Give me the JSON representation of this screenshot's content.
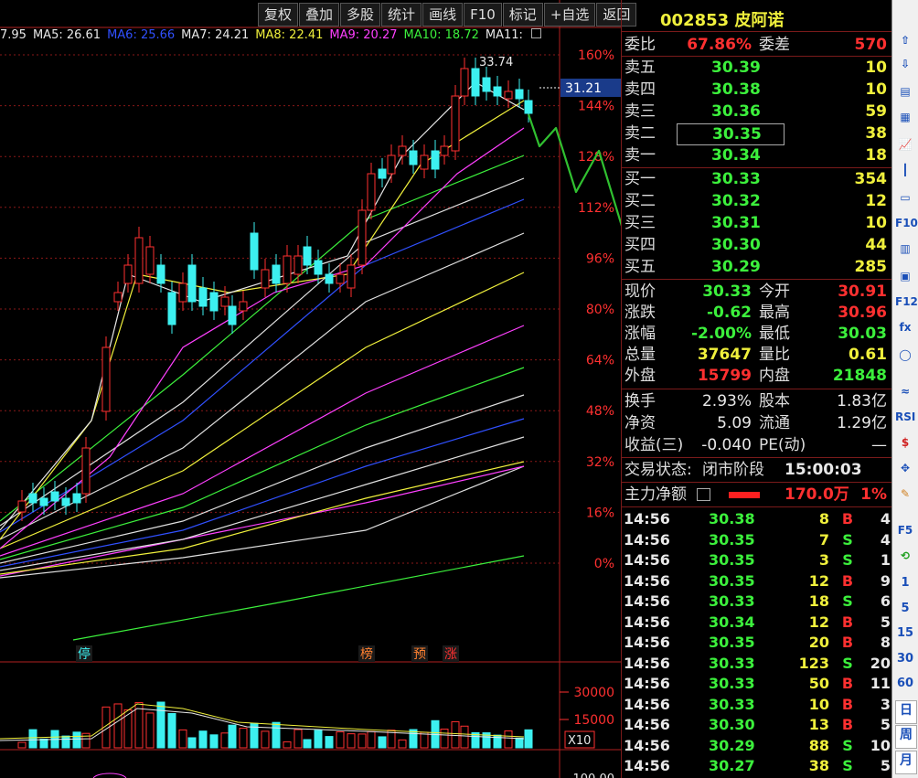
{
  "toolbar": [
    "复权",
    "叠加",
    "多股",
    "统计",
    "画线",
    "F10",
    "标记",
    "+自选",
    "返回"
  ],
  "ma_legend": [
    {
      "label": "7.95",
      "color": "#e8e8e8"
    },
    {
      "label": "MA5: 26.61",
      "color": "#e8e8e8"
    },
    {
      "label": "MA6: 25.66",
      "color": "#3050ff"
    },
    {
      "label": "MA7: 24.21",
      "color": "#e8e8e8"
    },
    {
      "label": "MA8: 22.41",
      "color": "#f0f03c"
    },
    {
      "label": "MA9: 20.27",
      "color": "#ff40ff"
    },
    {
      "label": "MA10: 18.72",
      "color": "#3cf03c"
    },
    {
      "label": "MA11:",
      "color": "#e8e8e8"
    }
  ],
  "axis_pct": [
    "160%",
    "144%",
    "128%",
    "112%",
    "96%",
    "80%",
    "64%",
    "48%",
    "32%",
    "16%",
    "0%"
  ],
  "price_tag": "31.21",
  "high_label": "33.74",
  "markers": [
    {
      "text": "停",
      "color": "#3cf0f0"
    },
    {
      "text": "榜",
      "color": "#ff8030"
    },
    {
      "text": "预",
      "color": "#ff8030"
    },
    {
      "text": "涨",
      "color": "#ff3030"
    }
  ],
  "vol_axis": [
    "30000",
    "15000"
  ],
  "vol_unit": "X10",
  "bottom_axis_label": "100.00",
  "quote": {
    "code": "002853",
    "name": "皮阿诺",
    "weibi_label": "委比",
    "weibi": "67.86%",
    "weicha_label": "委差",
    "weicha": "570",
    "asks": [
      {
        "label": "卖五",
        "price": "30.39",
        "vol": "10"
      },
      {
        "label": "卖四",
        "price": "30.38",
        "vol": "10"
      },
      {
        "label": "卖三",
        "price": "30.36",
        "vol": "59"
      },
      {
        "label": "卖二",
        "price": "30.35",
        "vol": "38"
      },
      {
        "label": "卖一",
        "price": "30.34",
        "vol": "18"
      }
    ],
    "bids": [
      {
        "label": "买一",
        "price": "30.33",
        "vol": "354"
      },
      {
        "label": "买二",
        "price": "30.32",
        "vol": "12"
      },
      {
        "label": "买三",
        "price": "30.31",
        "vol": "10"
      },
      {
        "label": "买四",
        "price": "30.30",
        "vol": "44"
      },
      {
        "label": "买五",
        "price": "30.29",
        "vol": "285"
      }
    ],
    "stats": [
      {
        "l1": "现价",
        "v1": "30.33",
        "c1": "green",
        "l2": "今开",
        "v2": "30.91",
        "c2": "red"
      },
      {
        "l1": "涨跌",
        "v1": "-0.62",
        "c1": "green",
        "l2": "最高",
        "v2": "30.96",
        "c2": "red"
      },
      {
        "l1": "涨幅",
        "v1": "-2.00%",
        "c1": "green",
        "l2": "最低",
        "v2": "30.03",
        "c2": "green"
      },
      {
        "l1": "总量",
        "v1": "37647",
        "c1": "yellow",
        "l2": "量比",
        "v2": "0.61",
        "c2": "yellow"
      },
      {
        "l1": "外盘",
        "v1": "15799",
        "c1": "red",
        "l2": "内盘",
        "v2": "21848",
        "c2": "green"
      }
    ],
    "stats2": [
      {
        "l1": "换手",
        "v1": "2.93%",
        "l2": "股本",
        "v2": "1.83亿"
      },
      {
        "l1": "净资",
        "v1": "5.09",
        "l2": "流通",
        "v2": "1.29亿"
      },
      {
        "l1": "收益(三)",
        "v1": "-0.040",
        "l2": "PE(动)",
        "v2": "—"
      }
    ],
    "trade_state_label": "交易状态:",
    "trade_state": "闭市阶段",
    "trade_time": "15:00:03",
    "main_flow_label": "主力净额",
    "main_flow_value": "170.0万",
    "main_flow_pct": "1%"
  },
  "ticks": [
    {
      "t": "14:56",
      "p": "30.38",
      "q": "8",
      "d": "B",
      "n": "4"
    },
    {
      "t": "14:56",
      "p": "30.35",
      "q": "7",
      "d": "S",
      "n": "4"
    },
    {
      "t": "14:56",
      "p": "30.35",
      "q": "3",
      "d": "S",
      "n": "1"
    },
    {
      "t": "14:56",
      "p": "30.35",
      "q": "12",
      "d": "B",
      "n": "9"
    },
    {
      "t": "14:56",
      "p": "30.33",
      "q": "18",
      "d": "S",
      "n": "6"
    },
    {
      "t": "14:56",
      "p": "30.34",
      "q": "12",
      "d": "B",
      "n": "5"
    },
    {
      "t": "14:56",
      "p": "30.35",
      "q": "20",
      "d": "B",
      "n": "8"
    },
    {
      "t": "14:56",
      "p": "30.33",
      "q": "123",
      "d": "S",
      "n": "20"
    },
    {
      "t": "14:56",
      "p": "30.33",
      "q": "50",
      "d": "B",
      "n": "11"
    },
    {
      "t": "14:56",
      "p": "30.33",
      "q": "10",
      "d": "B",
      "n": "3"
    },
    {
      "t": "14:56",
      "p": "30.30",
      "q": "13",
      "d": "B",
      "n": "5"
    },
    {
      "t": "14:56",
      "p": "30.29",
      "q": "88",
      "d": "S",
      "n": "10"
    },
    {
      "t": "14:56",
      "p": "30.27",
      "q": "38",
      "d": "S",
      "n": "5"
    }
  ],
  "sidebar": {
    "icons": [
      "arrow-up-icon",
      "arrow-down-icon",
      "list-icon",
      "grid-icon",
      "line-chart-icon",
      "candle-icon",
      "window-icon",
      "f10-icon",
      "chart2-icon",
      "doc-icon",
      "f12-icon",
      "fx-icon",
      "circle-icon",
      "wave-icon",
      "rsi-icon",
      "dollar-icon",
      "move-icon",
      "pencil-icon",
      "f5-icon",
      "refresh-icon"
    ],
    "texts": {
      "rsi": "RSI",
      "f5": "F5",
      "f10": "F10",
      "f12": "F12",
      "fx": "fx"
    },
    "periods": [
      "1",
      "5",
      "15",
      "30",
      "60",
      "日",
      "周",
      "月"
    ]
  }
}
